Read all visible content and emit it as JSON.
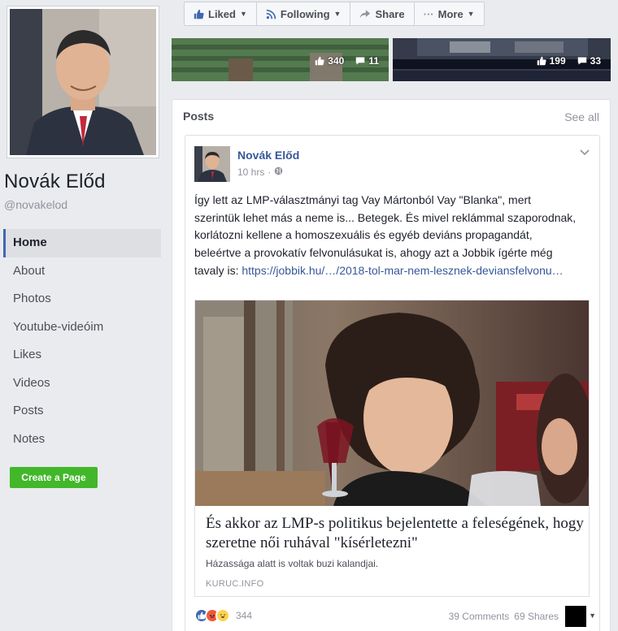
{
  "profile": {
    "name": "Novák Előd",
    "handle": "@novakelod"
  },
  "nav": {
    "items": [
      {
        "label": "Home",
        "active": true
      },
      {
        "label": "About"
      },
      {
        "label": "Photos"
      },
      {
        "label": "Youtube-videóim"
      },
      {
        "label": "Likes"
      },
      {
        "label": "Videos"
      },
      {
        "label": "Posts"
      },
      {
        "label": "Notes"
      }
    ],
    "create_page_label": "Create a Page"
  },
  "actionbar": {
    "liked_label": "Liked",
    "following_label": "Following",
    "share_label": "Share",
    "more_label": "More"
  },
  "photos": [
    {
      "likes": "340",
      "comments": "11"
    },
    {
      "likes": "199",
      "comments": "33"
    }
  ],
  "posts_section": {
    "header": "Posts",
    "see_all": "See all"
  },
  "post": {
    "author": "Novák Előd",
    "time": "10 hrs",
    "privacy_icon": "globe-icon",
    "text": "Így lett az LMP-választmányi tag Vay Mártonból Vay \"Blanka\", mert szerintük lehet más a neme is... Betegek. És mivel reklámmal szaporodnak, korlátozni kellene a homoszexuális és egyéb deviáns propagandát, beleértve a provokatív felvonulásukat is, ahogy azt a Jobbik ígérte még tavaly is:",
    "link_text": "https://jobbik.hu/…/2018-tol-mar-nem-lesznek-deviansfelvonu…",
    "preview": {
      "title": "És akkor az LMP-s politikus bejelentette a feleségének, hogy szeretne női ruhával \"kísérletezni\"",
      "description": "Házassága alatt is voltak buzi kalandjai.",
      "domain": "KURUC.INFO"
    },
    "reactions_count": "344",
    "comments_count": "39 Comments",
    "shares_count": "69 Shares"
  },
  "colors": {
    "brand_blue": "#4267b2",
    "link_blue": "#365899",
    "create_green": "#42b72a",
    "bg": "#e9ebee"
  }
}
